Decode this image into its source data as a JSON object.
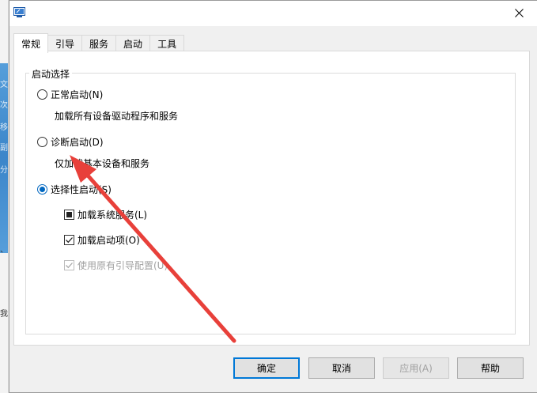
{
  "background": {
    "glyphs": [
      "文",
      "次",
      "移",
      "副",
      "分"
    ],
    "small_texts": [
      "、",
      "我"
    ]
  },
  "tabs": [
    {
      "label": "常规",
      "active": true
    },
    {
      "label": "引导",
      "active": false
    },
    {
      "label": "服务",
      "active": false
    },
    {
      "label": "启动",
      "active": false
    },
    {
      "label": "工具",
      "active": false
    }
  ],
  "group": {
    "legend": "启动选择",
    "normal": {
      "label": "正常启动(N)",
      "desc": "加载所有设备驱动程序和服务"
    },
    "diagnostic": {
      "label": "诊断启动(D)",
      "desc": "仅加载基本设备和服务"
    },
    "selective": {
      "label": "选择性启动(S)"
    },
    "options": {
      "system_services": "加载系统服务(L)",
      "startup_items": "加载启动项(O)",
      "original_boot": "使用原有引导配置(U)"
    }
  },
  "buttons": {
    "ok": "确定",
    "cancel": "取消",
    "apply": "应用(A)",
    "help": "帮助"
  },
  "colors": {
    "accent": "#0078d7",
    "annotation_arrow": "#e8403a"
  }
}
